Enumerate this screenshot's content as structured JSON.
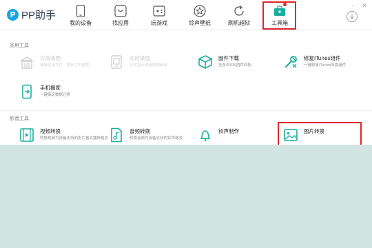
{
  "app": {
    "name": "PP助手",
    "logo_letter": "P"
  },
  "nav": [
    {
      "label": "我的设备",
      "icon": "phone-icon"
    },
    {
      "label": "找应用",
      "icon": "app-bag-icon"
    },
    {
      "label": "玩游戏",
      "icon": "gamepad-icon"
    },
    {
      "label": "铃声壁纸",
      "icon": "star-icon"
    },
    {
      "label": "刷机越狱",
      "icon": "refresh-icon"
    },
    {
      "label": "工具箱",
      "icon": "toolbox-icon",
      "active": true
    }
  ],
  "sections": {
    "utilities": {
      "title": "实用工具",
      "tools": [
        {
          "name": "垃圾清理",
          "desc": "清除垃圾文件，提升手机速度",
          "icon": "broom-icon",
          "enabled": false
        },
        {
          "name": "实时桌面",
          "desc": "实时显示设备屏幕画面",
          "icon": "monitor-icon",
          "enabled": false
        },
        {
          "name": "固件下载",
          "desc": "全系列iOS固件匹配",
          "icon": "box-icon",
          "enabled": true
        },
        {
          "name": "修复iTunes组件",
          "desc": "一键修复iTunes所需组件",
          "icon": "repair-icon",
          "enabled": true
        },
        {
          "name": "手机搬家",
          "desc": "一键搞定数据迁移",
          "icon": "phone-move-icon",
          "enabled": true
        }
      ]
    },
    "media": {
      "title": "影音工具",
      "tools": [
        {
          "name": "视频转换",
          "desc": "转换视频为设备支持的影片格式播放格式",
          "icon": "film-icon"
        },
        {
          "name": "音频转换",
          "desc": "转换音频为设备支持的铃声格式",
          "icon": "music-file-icon"
        },
        {
          "name": "铃声制作",
          "desc": "",
          "icon": "bell-icon"
        },
        {
          "name": "图片转换",
          "desc": "",
          "icon": "image-icon"
        }
      ]
    }
  },
  "colors": {
    "accent": "#19a3e0",
    "tool_green": "#1aae9f",
    "highlight": "#e0262b",
    "backdrop": "#d1e6e2"
  }
}
